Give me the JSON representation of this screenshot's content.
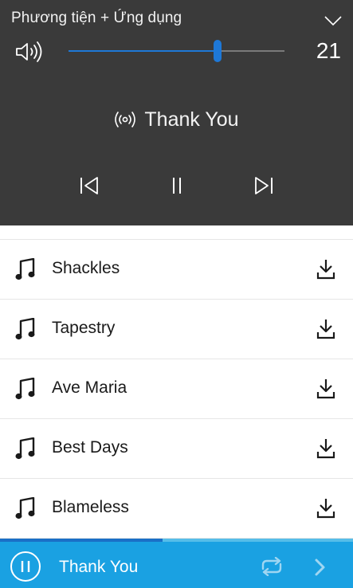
{
  "flyout": {
    "title": "Phương tiện + Ứng dụng",
    "volume": 21,
    "volume_fraction": 0.69,
    "now_playing": "Thank You",
    "icons": {
      "collapse": "chevron-down-icon",
      "speaker": "speaker-icon",
      "broadcast": "broadcast-icon",
      "previous": "previous-track-icon",
      "pause": "pause-icon",
      "next": "next-track-icon"
    },
    "accent_color": "#1e78d7",
    "background_color": "#3a3a3a"
  },
  "songs": [
    {
      "title": "Shackles"
    },
    {
      "title": "Tapestry"
    },
    {
      "title": "Ave Maria"
    },
    {
      "title": "Best Days"
    },
    {
      "title": "Blameless"
    }
  ],
  "list_icons": {
    "song": "music-note-icon",
    "download": "download-icon"
  },
  "mini_player": {
    "title": "Thank You",
    "progress_fraction": 0.46,
    "background_color": "#1aa1e2",
    "icons": {
      "pause": "pause-circle-icon",
      "repeat": "repeat-icon",
      "next": "chevron-right-icon"
    }
  }
}
